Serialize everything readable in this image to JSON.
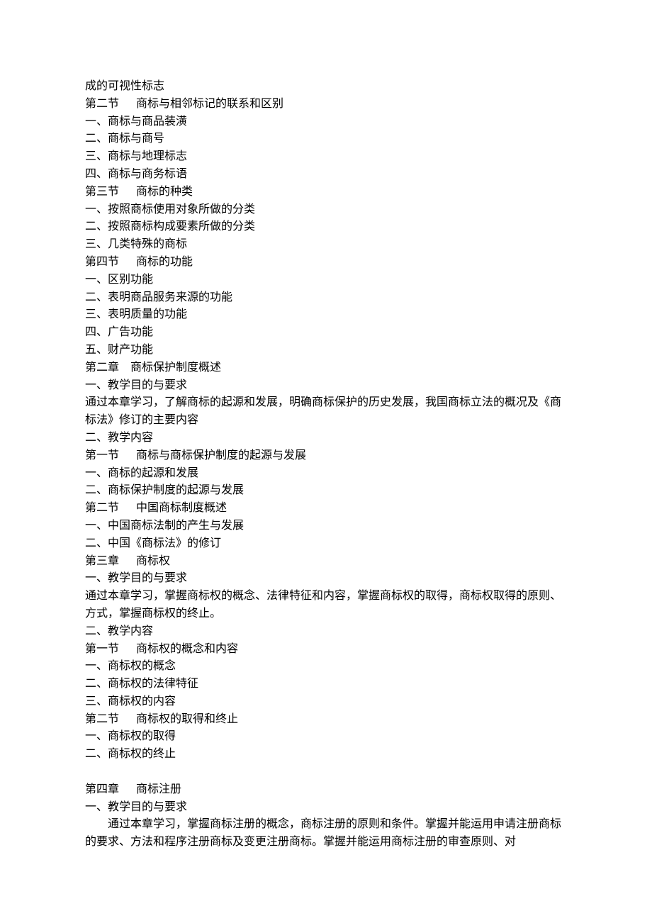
{
  "lines": [
    "成的可视性标志",
    "第二节      商标与相邻标记的联系和区别",
    "一、商标与商品装潢",
    "二、商标与商号",
    "三、商标与地理标志",
    "四、商标与商务标语",
    "第三节      商标的种类",
    "一、按照商标使用对象所做的分类",
    "二、按照商标构成要素所做的分类",
    "三、几类特殊的商标",
    "第四节      商标的功能",
    "一、区别功能",
    "二、表明商品服务来源的功能",
    "三、表明质量的功能",
    "四、广告功能",
    "五、财产功能",
    "第二章    商标保护制度概述",
    "一、教学目的与要求",
    "通过本章学习，了解商标的起源和发展，明确商标保护的历史发展，我国商标立法的概况及《商标法》修订的主要内容",
    "二、教学内容",
    "第一节      商标与商标保护制度的起源与发展",
    "一、商标的起源和发展",
    "二、商标保护制度的起源与发展",
    "第二节      中国商标制度概述",
    "一、中国商标法制的产生与发展",
    "二、中国《商标法》的修订",
    "第三章      商标权",
    "一、教学目的与要求",
    "通过本章学习，掌握商标权的概念、法律特征和内容，掌握商标权的取得，商标权取得的原则、方式，掌握商标权的终止。",
    "二、教学内容",
    "第一节      商标权的概念和内容",
    "一、商标权的概念",
    "二、商标权的法律特征",
    "三、商标权的内容",
    "第二节      商标权的取得和终止",
    "一、商标权的取得",
    "二、商标权的终止"
  ],
  "ch4": {
    "title": "第四章      商标注册",
    "req_label": "一、教学目的与要求",
    "para": "通过本章学习，掌握商标注册的概念，商标注册的原则和条件。掌握并能运用申请注册商标的要求、方法和程序注册商标及变更注册商标。掌握并能运用商标注册的审查原则、对"
  }
}
